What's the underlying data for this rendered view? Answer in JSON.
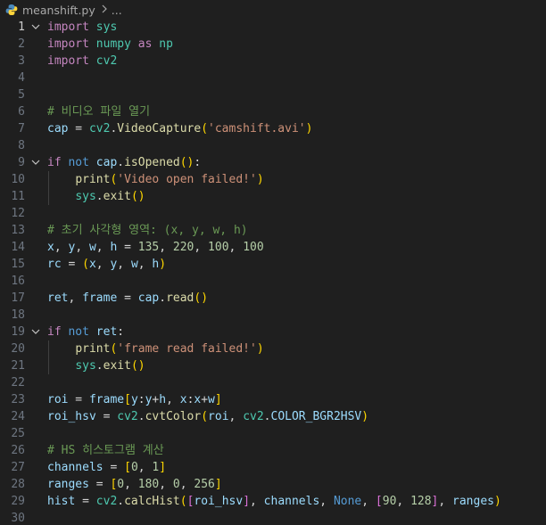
{
  "breadcrumb": {
    "file": "meanshift.py",
    "more": "..."
  },
  "icons": {
    "file_icon": "python-file-icon",
    "separator": "chevron-right-icon",
    "fold": "chevron-down-icon"
  },
  "colors": {
    "background": "#1f1f1f",
    "keyword": "#c586c0",
    "module": "#4ec9b0",
    "variable": "#9cdcfe",
    "function": "#dcdcaa",
    "string": "#ce9178",
    "number": "#b5cea8",
    "comment": "#6a9955",
    "line_number": "#6e7681",
    "bracket_1": "#ffd700",
    "bracket_2": "#da70d6",
    "bracket_3": "#179fff"
  },
  "editor": {
    "active_line": 1,
    "lines": [
      {
        "n": "1",
        "fold": true,
        "tokens": [
          [
            "kw",
            "import"
          ],
          [
            "op",
            " "
          ],
          [
            "mod",
            "sys"
          ]
        ]
      },
      {
        "n": "2",
        "tokens": [
          [
            "kw",
            "import"
          ],
          [
            "op",
            " "
          ],
          [
            "mod",
            "numpy"
          ],
          [
            "op",
            " "
          ],
          [
            "kw",
            "as"
          ],
          [
            "op",
            " "
          ],
          [
            "mod",
            "np"
          ]
        ]
      },
      {
        "n": "3",
        "tokens": [
          [
            "kw",
            "import"
          ],
          [
            "op",
            " "
          ],
          [
            "mod",
            "cv2"
          ]
        ]
      },
      {
        "n": "4",
        "tokens": []
      },
      {
        "n": "5",
        "tokens": []
      },
      {
        "n": "6",
        "tokens": [
          [
            "cmt",
            "# 비디오 파일 열기"
          ]
        ]
      },
      {
        "n": "7",
        "tokens": [
          [
            "var",
            "cap"
          ],
          [
            "op",
            " = "
          ],
          [
            "mod",
            "cv2"
          ],
          [
            "op",
            "."
          ],
          [
            "fn",
            "VideoCapture"
          ],
          [
            "br1",
            "("
          ],
          [
            "str",
            "'camshift.avi'"
          ],
          [
            "br1",
            ")"
          ]
        ]
      },
      {
        "n": "8",
        "tokens": []
      },
      {
        "n": "9",
        "fold": true,
        "tokens": [
          [
            "kw",
            "if"
          ],
          [
            "op",
            " "
          ],
          [
            "kw2",
            "not"
          ],
          [
            "op",
            " "
          ],
          [
            "var",
            "cap"
          ],
          [
            "op",
            "."
          ],
          [
            "fn",
            "isOpened"
          ],
          [
            "br1",
            "()"
          ],
          [
            "op",
            ":"
          ]
        ]
      },
      {
        "n": "10",
        "guide": true,
        "tokens": [
          [
            "op",
            "    "
          ],
          [
            "fn",
            "print"
          ],
          [
            "br1",
            "("
          ],
          [
            "str",
            "'Video open failed!'"
          ],
          [
            "br1",
            ")"
          ]
        ]
      },
      {
        "n": "11",
        "guide": true,
        "tokens": [
          [
            "op",
            "    "
          ],
          [
            "mod",
            "sys"
          ],
          [
            "op",
            "."
          ],
          [
            "fn",
            "exit"
          ],
          [
            "br1",
            "()"
          ]
        ]
      },
      {
        "n": "12",
        "tokens": []
      },
      {
        "n": "13",
        "tokens": [
          [
            "cmt",
            "# 초기 사각형 영역: (x, y, w, h)"
          ]
        ]
      },
      {
        "n": "14",
        "tokens": [
          [
            "var",
            "x"
          ],
          [
            "op",
            ", "
          ],
          [
            "var",
            "y"
          ],
          [
            "op",
            ", "
          ],
          [
            "var",
            "w"
          ],
          [
            "op",
            ", "
          ],
          [
            "var",
            "h"
          ],
          [
            "op",
            " = "
          ],
          [
            "num",
            "135"
          ],
          [
            "op",
            ", "
          ],
          [
            "num",
            "220"
          ],
          [
            "op",
            ", "
          ],
          [
            "num",
            "100"
          ],
          [
            "op",
            ", "
          ],
          [
            "num",
            "100"
          ]
        ]
      },
      {
        "n": "15",
        "tokens": [
          [
            "var",
            "rc"
          ],
          [
            "op",
            " = "
          ],
          [
            "br1",
            "("
          ],
          [
            "var",
            "x"
          ],
          [
            "op",
            ", "
          ],
          [
            "var",
            "y"
          ],
          [
            "op",
            ", "
          ],
          [
            "var",
            "w"
          ],
          [
            "op",
            ", "
          ],
          [
            "var",
            "h"
          ],
          [
            "br1",
            ")"
          ]
        ]
      },
      {
        "n": "16",
        "tokens": []
      },
      {
        "n": "17",
        "tokens": [
          [
            "var",
            "ret"
          ],
          [
            "op",
            ", "
          ],
          [
            "var",
            "frame"
          ],
          [
            "op",
            " = "
          ],
          [
            "var",
            "cap"
          ],
          [
            "op",
            "."
          ],
          [
            "fn",
            "read"
          ],
          [
            "br1",
            "()"
          ]
        ]
      },
      {
        "n": "18",
        "tokens": []
      },
      {
        "n": "19",
        "fold": true,
        "tokens": [
          [
            "kw",
            "if"
          ],
          [
            "op",
            " "
          ],
          [
            "kw2",
            "not"
          ],
          [
            "op",
            " "
          ],
          [
            "var",
            "ret"
          ],
          [
            "op",
            ":"
          ]
        ]
      },
      {
        "n": "20",
        "guide": true,
        "tokens": [
          [
            "op",
            "    "
          ],
          [
            "fn",
            "print"
          ],
          [
            "br1",
            "("
          ],
          [
            "str",
            "'frame read failed!'"
          ],
          [
            "br1",
            ")"
          ]
        ]
      },
      {
        "n": "21",
        "guide": true,
        "tokens": [
          [
            "op",
            "    "
          ],
          [
            "mod",
            "sys"
          ],
          [
            "op",
            "."
          ],
          [
            "fn",
            "exit"
          ],
          [
            "br1",
            "()"
          ]
        ]
      },
      {
        "n": "22",
        "tokens": []
      },
      {
        "n": "23",
        "tokens": [
          [
            "var",
            "roi"
          ],
          [
            "op",
            " = "
          ],
          [
            "var",
            "frame"
          ],
          [
            "br1",
            "["
          ],
          [
            "var",
            "y"
          ],
          [
            "op",
            ":"
          ],
          [
            "var",
            "y"
          ],
          [
            "op",
            "+"
          ],
          [
            "var",
            "h"
          ],
          [
            "op",
            ", "
          ],
          [
            "var",
            "x"
          ],
          [
            "op",
            ":"
          ],
          [
            "var",
            "x"
          ],
          [
            "op",
            "+"
          ],
          [
            "var",
            "w"
          ],
          [
            "br1",
            "]"
          ]
        ]
      },
      {
        "n": "24",
        "tokens": [
          [
            "var",
            "roi_hsv"
          ],
          [
            "op",
            " = "
          ],
          [
            "mod",
            "cv2"
          ],
          [
            "op",
            "."
          ],
          [
            "fn",
            "cvtColor"
          ],
          [
            "br1",
            "("
          ],
          [
            "var",
            "roi"
          ],
          [
            "op",
            ", "
          ],
          [
            "mod",
            "cv2"
          ],
          [
            "op",
            "."
          ],
          [
            "var",
            "COLOR_BGR2HSV"
          ],
          [
            "br1",
            ")"
          ]
        ]
      },
      {
        "n": "25",
        "tokens": []
      },
      {
        "n": "26",
        "tokens": [
          [
            "cmt",
            "# HS 히스토그램 계산"
          ]
        ]
      },
      {
        "n": "27",
        "tokens": [
          [
            "var",
            "channels"
          ],
          [
            "op",
            " = "
          ],
          [
            "br1",
            "["
          ],
          [
            "num",
            "0"
          ],
          [
            "op",
            ", "
          ],
          [
            "num",
            "1"
          ],
          [
            "br1",
            "]"
          ]
        ]
      },
      {
        "n": "28",
        "tokens": [
          [
            "var",
            "ranges"
          ],
          [
            "op",
            " = "
          ],
          [
            "br1",
            "["
          ],
          [
            "num",
            "0"
          ],
          [
            "op",
            ", "
          ],
          [
            "num",
            "180"
          ],
          [
            "op",
            ", "
          ],
          [
            "num",
            "0"
          ],
          [
            "op",
            ", "
          ],
          [
            "num",
            "256"
          ],
          [
            "br1",
            "]"
          ]
        ]
      },
      {
        "n": "29",
        "tokens": [
          [
            "var",
            "hist"
          ],
          [
            "op",
            " = "
          ],
          [
            "mod",
            "cv2"
          ],
          [
            "op",
            "."
          ],
          [
            "fn",
            "calcHist"
          ],
          [
            "br1",
            "("
          ],
          [
            "br2",
            "["
          ],
          [
            "var",
            "roi_hsv"
          ],
          [
            "br2",
            "]"
          ],
          [
            "op",
            ", "
          ],
          [
            "var",
            "channels"
          ],
          [
            "op",
            ", "
          ],
          [
            "const",
            "None"
          ],
          [
            "op",
            ", "
          ],
          [
            "br2",
            "["
          ],
          [
            "num",
            "90"
          ],
          [
            "op",
            ", "
          ],
          [
            "num",
            "128"
          ],
          [
            "br2",
            "]"
          ],
          [
            "op",
            ", "
          ],
          [
            "var",
            "ranges"
          ],
          [
            "br1",
            ")"
          ]
        ]
      },
      {
        "n": "30",
        "tokens": []
      }
    ]
  }
}
